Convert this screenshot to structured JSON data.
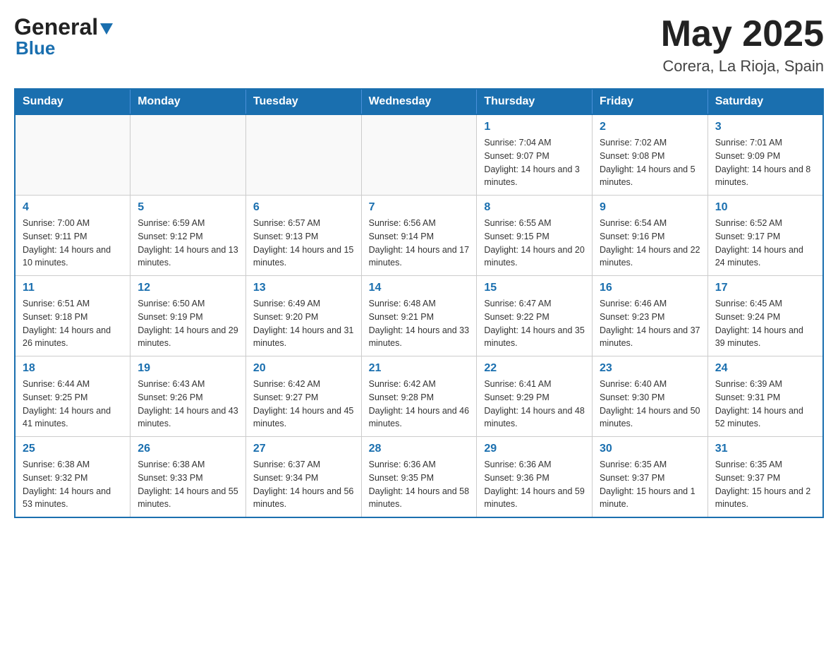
{
  "header": {
    "logo_general": "General",
    "logo_blue": "Blue",
    "month_title": "May 2025",
    "location": "Corera, La Rioja, Spain"
  },
  "days_of_week": [
    "Sunday",
    "Monday",
    "Tuesday",
    "Wednesday",
    "Thursday",
    "Friday",
    "Saturday"
  ],
  "weeks": [
    [
      {
        "day": "",
        "info": ""
      },
      {
        "day": "",
        "info": ""
      },
      {
        "day": "",
        "info": ""
      },
      {
        "day": "",
        "info": ""
      },
      {
        "day": "1",
        "info": "Sunrise: 7:04 AM\nSunset: 9:07 PM\nDaylight: 14 hours and 3 minutes."
      },
      {
        "day": "2",
        "info": "Sunrise: 7:02 AM\nSunset: 9:08 PM\nDaylight: 14 hours and 5 minutes."
      },
      {
        "day": "3",
        "info": "Sunrise: 7:01 AM\nSunset: 9:09 PM\nDaylight: 14 hours and 8 minutes."
      }
    ],
    [
      {
        "day": "4",
        "info": "Sunrise: 7:00 AM\nSunset: 9:11 PM\nDaylight: 14 hours and 10 minutes."
      },
      {
        "day": "5",
        "info": "Sunrise: 6:59 AM\nSunset: 9:12 PM\nDaylight: 14 hours and 13 minutes."
      },
      {
        "day": "6",
        "info": "Sunrise: 6:57 AM\nSunset: 9:13 PM\nDaylight: 14 hours and 15 minutes."
      },
      {
        "day": "7",
        "info": "Sunrise: 6:56 AM\nSunset: 9:14 PM\nDaylight: 14 hours and 17 minutes."
      },
      {
        "day": "8",
        "info": "Sunrise: 6:55 AM\nSunset: 9:15 PM\nDaylight: 14 hours and 20 minutes."
      },
      {
        "day": "9",
        "info": "Sunrise: 6:54 AM\nSunset: 9:16 PM\nDaylight: 14 hours and 22 minutes."
      },
      {
        "day": "10",
        "info": "Sunrise: 6:52 AM\nSunset: 9:17 PM\nDaylight: 14 hours and 24 minutes."
      }
    ],
    [
      {
        "day": "11",
        "info": "Sunrise: 6:51 AM\nSunset: 9:18 PM\nDaylight: 14 hours and 26 minutes."
      },
      {
        "day": "12",
        "info": "Sunrise: 6:50 AM\nSunset: 9:19 PM\nDaylight: 14 hours and 29 minutes."
      },
      {
        "day": "13",
        "info": "Sunrise: 6:49 AM\nSunset: 9:20 PM\nDaylight: 14 hours and 31 minutes."
      },
      {
        "day": "14",
        "info": "Sunrise: 6:48 AM\nSunset: 9:21 PM\nDaylight: 14 hours and 33 minutes."
      },
      {
        "day": "15",
        "info": "Sunrise: 6:47 AM\nSunset: 9:22 PM\nDaylight: 14 hours and 35 minutes."
      },
      {
        "day": "16",
        "info": "Sunrise: 6:46 AM\nSunset: 9:23 PM\nDaylight: 14 hours and 37 minutes."
      },
      {
        "day": "17",
        "info": "Sunrise: 6:45 AM\nSunset: 9:24 PM\nDaylight: 14 hours and 39 minutes."
      }
    ],
    [
      {
        "day": "18",
        "info": "Sunrise: 6:44 AM\nSunset: 9:25 PM\nDaylight: 14 hours and 41 minutes."
      },
      {
        "day": "19",
        "info": "Sunrise: 6:43 AM\nSunset: 9:26 PM\nDaylight: 14 hours and 43 minutes."
      },
      {
        "day": "20",
        "info": "Sunrise: 6:42 AM\nSunset: 9:27 PM\nDaylight: 14 hours and 45 minutes."
      },
      {
        "day": "21",
        "info": "Sunrise: 6:42 AM\nSunset: 9:28 PM\nDaylight: 14 hours and 46 minutes."
      },
      {
        "day": "22",
        "info": "Sunrise: 6:41 AM\nSunset: 9:29 PM\nDaylight: 14 hours and 48 minutes."
      },
      {
        "day": "23",
        "info": "Sunrise: 6:40 AM\nSunset: 9:30 PM\nDaylight: 14 hours and 50 minutes."
      },
      {
        "day": "24",
        "info": "Sunrise: 6:39 AM\nSunset: 9:31 PM\nDaylight: 14 hours and 52 minutes."
      }
    ],
    [
      {
        "day": "25",
        "info": "Sunrise: 6:38 AM\nSunset: 9:32 PM\nDaylight: 14 hours and 53 minutes."
      },
      {
        "day": "26",
        "info": "Sunrise: 6:38 AM\nSunset: 9:33 PM\nDaylight: 14 hours and 55 minutes."
      },
      {
        "day": "27",
        "info": "Sunrise: 6:37 AM\nSunset: 9:34 PM\nDaylight: 14 hours and 56 minutes."
      },
      {
        "day": "28",
        "info": "Sunrise: 6:36 AM\nSunset: 9:35 PM\nDaylight: 14 hours and 58 minutes."
      },
      {
        "day": "29",
        "info": "Sunrise: 6:36 AM\nSunset: 9:36 PM\nDaylight: 14 hours and 59 minutes."
      },
      {
        "day": "30",
        "info": "Sunrise: 6:35 AM\nSunset: 9:37 PM\nDaylight: 15 hours and 1 minute."
      },
      {
        "day": "31",
        "info": "Sunrise: 6:35 AM\nSunset: 9:37 PM\nDaylight: 15 hours and 2 minutes."
      }
    ]
  ]
}
